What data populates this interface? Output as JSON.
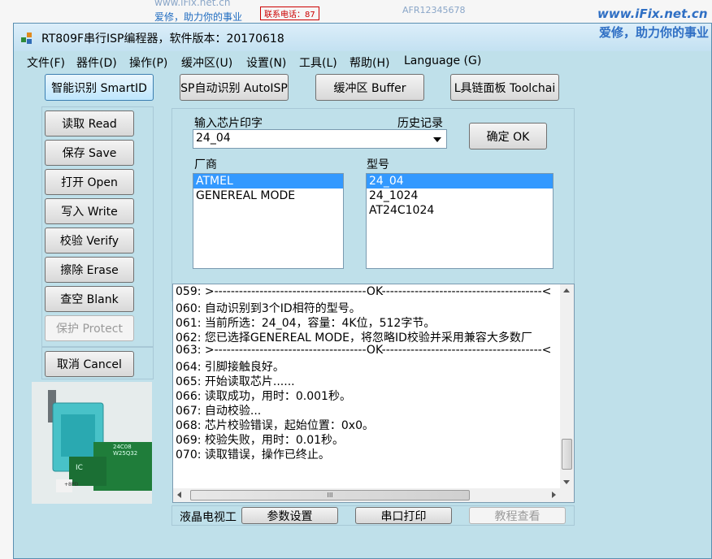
{
  "background": {
    "left_top": "",
    "brand_top": "爱修，助力你的事业",
    "watermark_top": "www.iFix.net.cn",
    "red_box_text": "联系电话：87",
    "blue_right_top": "AFR12345678",
    "watermark_url": "www.iFix.net.cn",
    "watermark_slogan": "爱修，助力你的事业"
  },
  "window": {
    "title": "RT809F串行ISP编程器，软件版本：20170618"
  },
  "menu": [
    "文件(F)",
    "器件(D)",
    "操作(P)",
    "缓冲区(U)",
    "设置(N)",
    "工具(L)",
    "帮助(H)",
    "Language (G)"
  ],
  "toolbar": {
    "smartid": "智能识别 SmartID",
    "autoisp": "SP自动识别 AutoISP",
    "buffer": "缓冲区 Buffer",
    "toolchain": "L具链面板 Toolchai"
  },
  "ops": {
    "read": "读取 Read",
    "save": "保存 Save",
    "open": "打开 Open",
    "write": "写入 Write",
    "verify": "校验 Verify",
    "erase": "擦除 Erase",
    "blank": "查空 Blank",
    "protect": "保护 Protect",
    "cancel": "取消 Cancel"
  },
  "chip": {
    "input_label": "输入芯片印字",
    "history_label": "历史记录",
    "input_value": "24_04",
    "ok": "确定 OK",
    "vendor_label": "厂商",
    "model_label": "型号",
    "vendors": [
      "ATMEL",
      "GENEREAL MODE"
    ],
    "models": [
      "24_04",
      "24_1024",
      "AT24C1024"
    ]
  },
  "log": [
    "059: >-------------------------------------OK---------------------------------------<",
    "060: 自动识别到3个ID相符的型号。",
    "061: 当前所选：24_04，容量：4K位，512字节。",
    "062: 您已选择GENEREAL MODE，将忽略ID校验并采用兼容大多数厂",
    "063: >-------------------------------------OK---------------------------------------<",
    "064: 引脚接触良好。",
    "065: 开始读取芯片......",
    "066: 读取成功，用时：0.001秒。",
    "067: 自动校验...",
    "068: 芯片校验错误，起始位置：0x0。",
    "069: 校验失败，用时：0.01秒。",
    "070: 读取错误，操作已终止。"
  ],
  "hscroll_grip": "III",
  "bottom": {
    "lcd_label": "液晶电视工",
    "params": "参数设置",
    "serial_print": "串口打印",
    "tutorial": "教程查看"
  },
  "device_image": {
    "chip_label": "24C08",
    "pcb_text": "IC",
    "pcb_text2": "W25Q32",
    "pin_label": "+8PD"
  }
}
